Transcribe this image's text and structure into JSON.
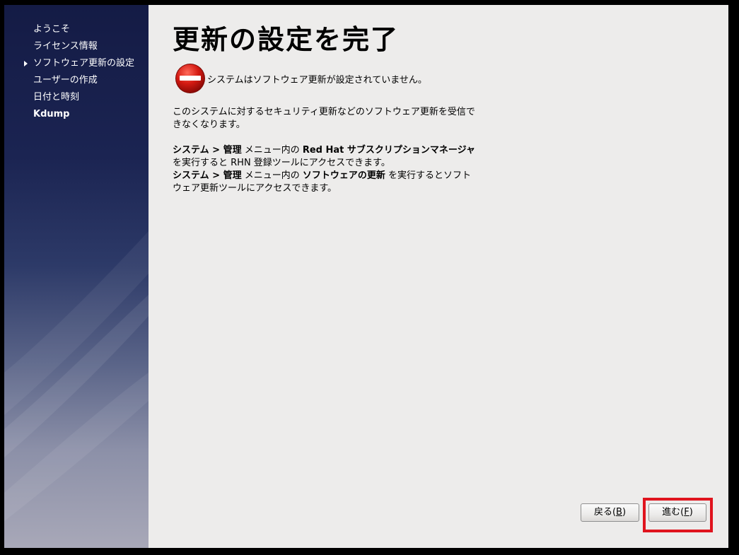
{
  "sidebar": {
    "items": [
      {
        "label": "ようこそ",
        "current": false
      },
      {
        "label": "ライセンス情報",
        "current": false
      },
      {
        "label": "ソフトウェア更新の設定",
        "current": true
      },
      {
        "label": "ユーザーの作成",
        "current": false
      },
      {
        "label": "日付と時刻",
        "current": false
      },
      {
        "label": "Kdump",
        "current": false
      }
    ]
  },
  "main": {
    "title": "更新の設定を完了",
    "status_icon": "stop-icon",
    "status_text": "システムはソフトウェア更新が設定されていません。",
    "description": "このシステムに対するセキュリティ更新などのソフトウェア更新を受信できなくなります。",
    "instructions": {
      "line1": {
        "menu1": "システム",
        "sep": " > ",
        "menu2": "管理",
        "mid": " メニュー内の ",
        "tool": "Red Hat サブスクリプションマネージャ",
        "tail": " を実行すると RHN 登録ツールにアクセスできます。"
      },
      "line2": {
        "menu1": "システム",
        "sep": " > ",
        "menu2": "管理",
        "mid": " メニュー内の ",
        "tool": "ソフトウェアの更新",
        "tail": " を実行するとソフトウェア更新ツールにアクセスできます。"
      }
    }
  },
  "buttons": {
    "back": {
      "text": "戻る(",
      "key": "B",
      "close": ")"
    },
    "forward": {
      "text": "進む(",
      "key": "F",
      "close": ")"
    }
  },
  "colors": {
    "highlight": "#e0141e",
    "content_bg": "#edeceb",
    "sidebar_top": "#141b45"
  }
}
